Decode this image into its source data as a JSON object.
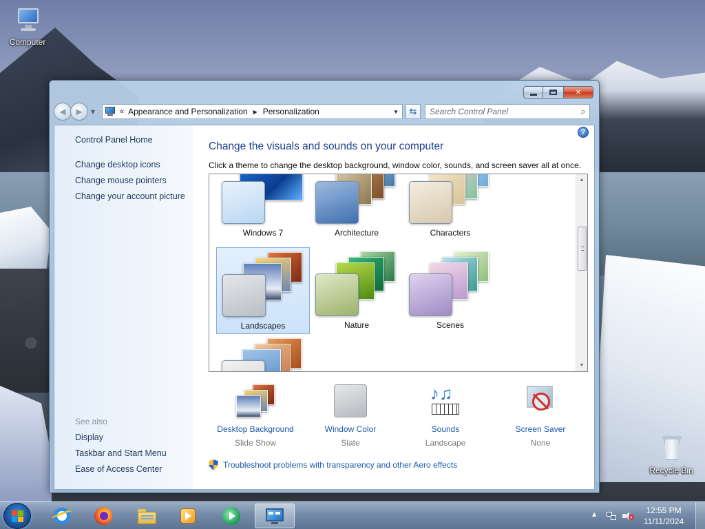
{
  "desktop": {
    "icons": [
      {
        "label": "Computer"
      },
      {
        "label": "Recycle Bin"
      }
    ]
  },
  "window": {
    "address": {
      "overflow": "«",
      "crumbs": [
        "Appearance and Personalization",
        "Personalization"
      ]
    },
    "search": {
      "placeholder": "Search Control Panel"
    },
    "help_label": "?",
    "left_pane": {
      "links": [
        "Control Panel Home",
        "Change desktop icons",
        "Change mouse pointers",
        "Change your account picture"
      ],
      "see_also_heading": "See also",
      "see_also": [
        "Display",
        "Taskbar and Start Menu",
        "Ease of Access Center"
      ]
    },
    "main": {
      "heading": "Change the visuals and sounds on your computer",
      "subtext": "Click a theme to change the desktop background, window color, sounds, and screen saver all at once.",
      "themes": [
        {
          "name": "Windows 7",
          "selected": false
        },
        {
          "name": "Architecture",
          "selected": false
        },
        {
          "name": "Characters",
          "selected": false
        },
        {
          "name": "Landscapes",
          "selected": true
        },
        {
          "name": "Nature",
          "selected": false
        },
        {
          "name": "Scenes",
          "selected": false
        },
        {
          "name": "",
          "selected": false
        }
      ],
      "settings": [
        {
          "title": "Desktop Background",
          "value": "Slide Show",
          "icon": "desktop-background-icon"
        },
        {
          "title": "Window Color",
          "value": "Slate",
          "icon": "window-color-icon"
        },
        {
          "title": "Sounds",
          "value": "Landscape",
          "icon": "sounds-icon"
        },
        {
          "title": "Screen Saver",
          "value": "None",
          "icon": "screen-saver-icon"
        }
      ],
      "troubleshoot_link": "Troubleshoot problems with transparency and other Aero effects"
    }
  },
  "taskbar": {
    "pinned": [
      "Internet Explorer",
      "Firefox",
      "Windows Explorer",
      "Windows Media Player",
      "Windows Media Center",
      "Control Panel"
    ],
    "active": "Control Panel",
    "clock": {
      "time": "12:55 PM",
      "date": "11/11/2024"
    }
  },
  "colors": {
    "link": "#1e5aa8",
    "heading": "#1e3f8c",
    "close_button": "#d7563c",
    "selection": "#cbe2fa"
  }
}
